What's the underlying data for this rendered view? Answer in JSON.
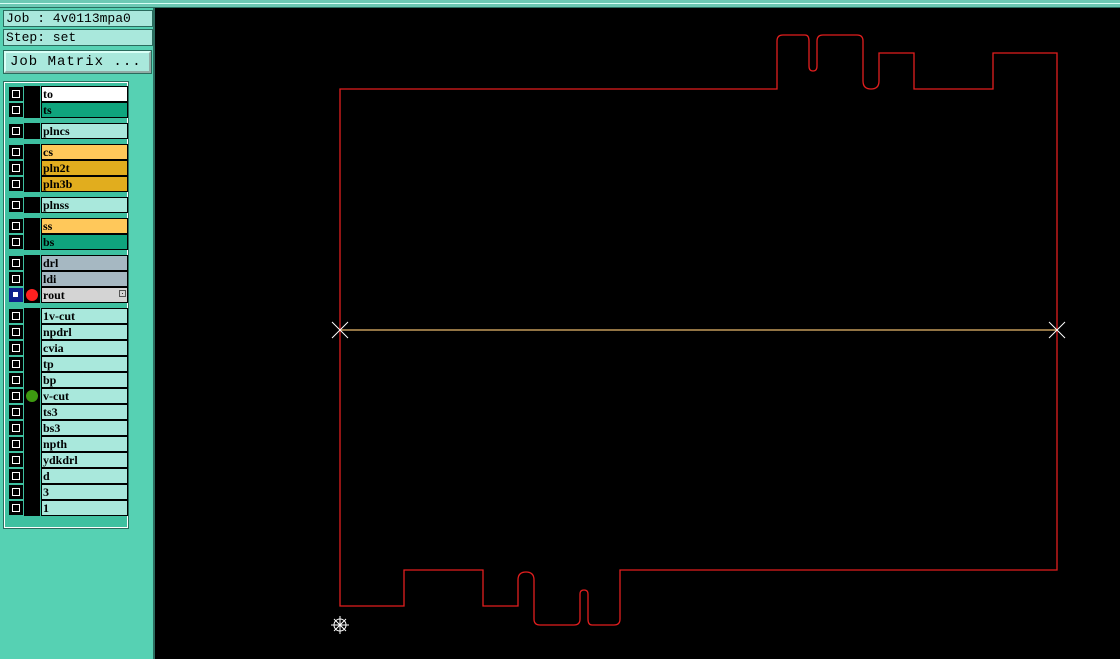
{
  "header": {
    "job": "Job : 4v0113mpa0",
    "step": "Step: set"
  },
  "buttons": {
    "job_matrix": "Job Matrix ..."
  },
  "colors": {
    "panel": "#56d1b3",
    "outline": "#e21e1e",
    "vcut_line": "#c39a5a",
    "active_dot": "#ff2020",
    "vcut_dot": "#3d9a10"
  },
  "layers": [
    {
      "name": "to",
      "color": "#ffffff"
    },
    {
      "name": "ts",
      "color": "#0fa47d"
    },
    {
      "name": "plncs",
      "color": "#a9e8dc"
    },
    {
      "name": "cs",
      "color": "#ffc85a"
    },
    {
      "name": "pln2t",
      "color": "#e1ad1e"
    },
    {
      "name": "pln3b",
      "color": "#e1ad1e"
    },
    {
      "name": "plnss",
      "color": "#a9e8dc"
    },
    {
      "name": "ss",
      "color": "#ffc85a"
    },
    {
      "name": "bs",
      "color": "#0fa47d"
    },
    {
      "name": "drl",
      "color": "#a6b8c2"
    },
    {
      "name": "ldi",
      "color": "#a6b8c2"
    },
    {
      "name": "rout",
      "color": "#d4d4d4",
      "selected": true,
      "dot": "#ff2020",
      "menu": true
    },
    {
      "name": "1v-cut",
      "color": "#a9e8dc"
    },
    {
      "name": "npdrl",
      "color": "#a9e8dc"
    },
    {
      "name": "cvia",
      "color": "#a9e8dc"
    },
    {
      "name": "tp",
      "color": "#a9e8dc"
    },
    {
      "name": "bp",
      "color": "#a9e8dc"
    },
    {
      "name": "v-cut",
      "color": "#a9e8dc",
      "dot": "#3d9a10"
    },
    {
      "name": "ts3",
      "color": "#a9e8dc"
    },
    {
      "name": "bs3",
      "color": "#a9e8dc"
    },
    {
      "name": "npth",
      "color": "#a9e8dc"
    },
    {
      "name": "ydkdrl",
      "color": "#a9e8dc"
    },
    {
      "name": "d",
      "color": "#a9e8dc"
    },
    {
      "name": "3",
      "color": "#a9e8dc"
    },
    {
      "name": "1",
      "color": "#a9e8dc"
    }
  ]
}
